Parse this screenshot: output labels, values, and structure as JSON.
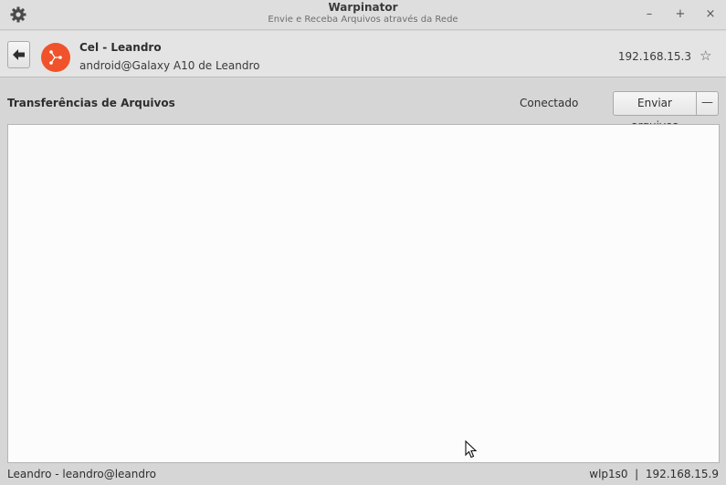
{
  "window": {
    "title": "Warpinator",
    "subtitle": "Envie e Receba Arquivos através da Rede",
    "controls": {
      "minimize": "–",
      "maximize": "+",
      "close": "×"
    },
    "menu_icon": "gear-icon"
  },
  "peer": {
    "name": "Cel - Leandro",
    "user_host": "android@Galaxy A10 de Leandro",
    "ip": "192.168.15.3",
    "avatar_color": "#f0532b",
    "avatar_icon": "network-share-icon",
    "favorite_icon": "☆"
  },
  "transfers": {
    "title": "Transferências de Arquivos",
    "status": "Conectado",
    "send_label": "Enviar arquivos",
    "menu_glyph": "—",
    "items": []
  },
  "statusbar": {
    "local_user": "Leandro - leandro@leandro",
    "interface_info": "wlp1s0  |  192.168.15.9"
  },
  "colors": {
    "accent": "#f0532b",
    "window_bg": "#d6d6d6",
    "list_bg": "#fcfcfc"
  }
}
